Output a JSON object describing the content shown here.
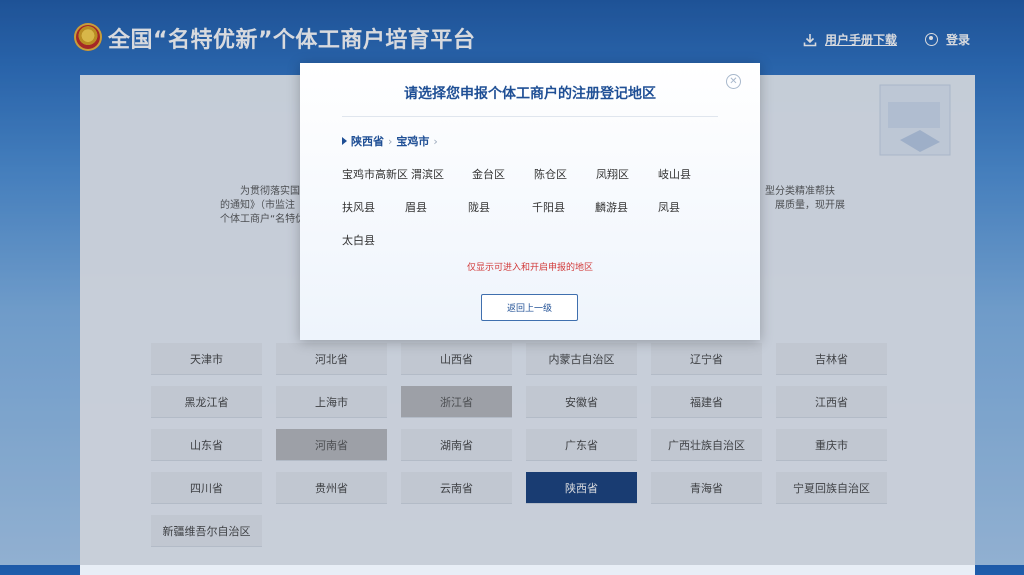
{
  "header": {
    "site_title": "全国“名特优新”个体工商户培育平台",
    "manual_label": "用户手册下载",
    "login_label": "登录"
  },
  "intro": {
    "left_lines": [
      "为贯彻落实国",
      "的通知》（市监注",
      "个体工商户“名特优"
    ],
    "right_lines": [
      "型分类精准帮扶",
      "展质量，现开展"
    ]
  },
  "provinces": [
    {
      "label": "天津市",
      "state": "normal"
    },
    {
      "label": "河北省",
      "state": "normal"
    },
    {
      "label": "山西省",
      "state": "normal"
    },
    {
      "label": "内蒙古自治区",
      "state": "normal"
    },
    {
      "label": "辽宁省",
      "state": "normal"
    },
    {
      "label": "吉林省",
      "state": "normal"
    },
    {
      "label": "黑龙江省",
      "state": "normal"
    },
    {
      "label": "上海市",
      "state": "normal"
    },
    {
      "label": "浙江省",
      "state": "gray"
    },
    {
      "label": "安徽省",
      "state": "normal"
    },
    {
      "label": "福建省",
      "state": "normal"
    },
    {
      "label": "江西省",
      "state": "normal"
    },
    {
      "label": "山东省",
      "state": "normal"
    },
    {
      "label": "河南省",
      "state": "gray"
    },
    {
      "label": "湖南省",
      "state": "normal"
    },
    {
      "label": "广东省",
      "state": "normal"
    },
    {
      "label": "广西壮族自治区",
      "state": "normal"
    },
    {
      "label": "重庆市",
      "state": "normal"
    },
    {
      "label": "四川省",
      "state": "normal"
    },
    {
      "label": "贵州省",
      "state": "normal"
    },
    {
      "label": "云南省",
      "state": "normal"
    },
    {
      "label": "陕西省",
      "state": "active"
    },
    {
      "label": "青海省",
      "state": "normal"
    },
    {
      "label": "宁夏回族自治区",
      "state": "normal"
    },
    {
      "label": "新疆维吾尔自治区",
      "state": "normal"
    }
  ],
  "modal": {
    "title": "请选择您申报个体工商户的注册登记地区",
    "close_icon": "close-circle-icon",
    "breadcrumb": [
      "陕西省",
      "宝鸡市"
    ],
    "areas": [
      "宝鸡市高新区",
      "渭滨区",
      "金台区",
      "陈仓区",
      "凤翔区",
      "岐山县",
      "扶风县",
      "眉县",
      "陇县",
      "千阳县",
      "麟游县",
      "凤县",
      "太白县"
    ],
    "note": "仅显示可进入和开启申报的地区",
    "back_label": "返回上一级"
  },
  "colors": {
    "accent": "#1f4f95",
    "active_province": "#163f7c",
    "note_red": "#d23b3b"
  }
}
